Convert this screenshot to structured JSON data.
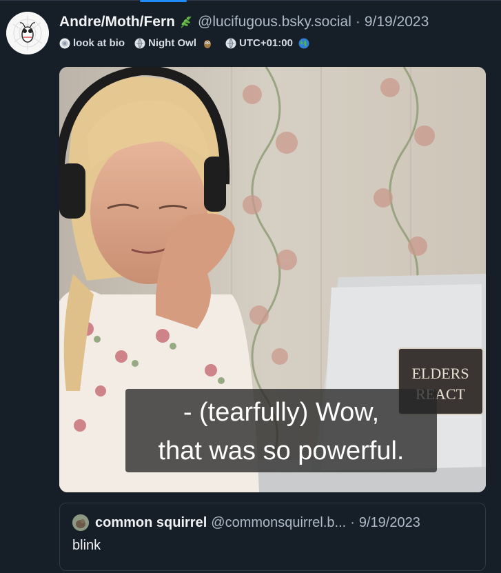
{
  "post": {
    "author": {
      "display_name": "Andre/Moth/Fern",
      "handle": "@lucifugous.bsky.social",
      "separator": "·",
      "date": "9/19/2023",
      "badges": [
        {
          "label": "look at bio",
          "icon": "bio-icon"
        },
        {
          "label": "Night Owl",
          "icon": "owl-icon"
        },
        {
          "label": "UTC+01:00",
          "icon": "globe-icon"
        }
      ]
    },
    "media": {
      "caption_line1": "- (tearfully) Wow,",
      "caption_line2": "that was so powerful.",
      "sign_line1": "ELDERS",
      "sign_line2": "REACT"
    },
    "quote": {
      "display_name": "common squirrel",
      "handle": "@commonsquirrel.b...",
      "separator": "·",
      "date": "9/19/2023",
      "text": "blink"
    }
  },
  "colors": {
    "background": "#161e27",
    "accent": "#208bfe",
    "muted_text": "#aebbc9",
    "border": "#2e3a48"
  }
}
